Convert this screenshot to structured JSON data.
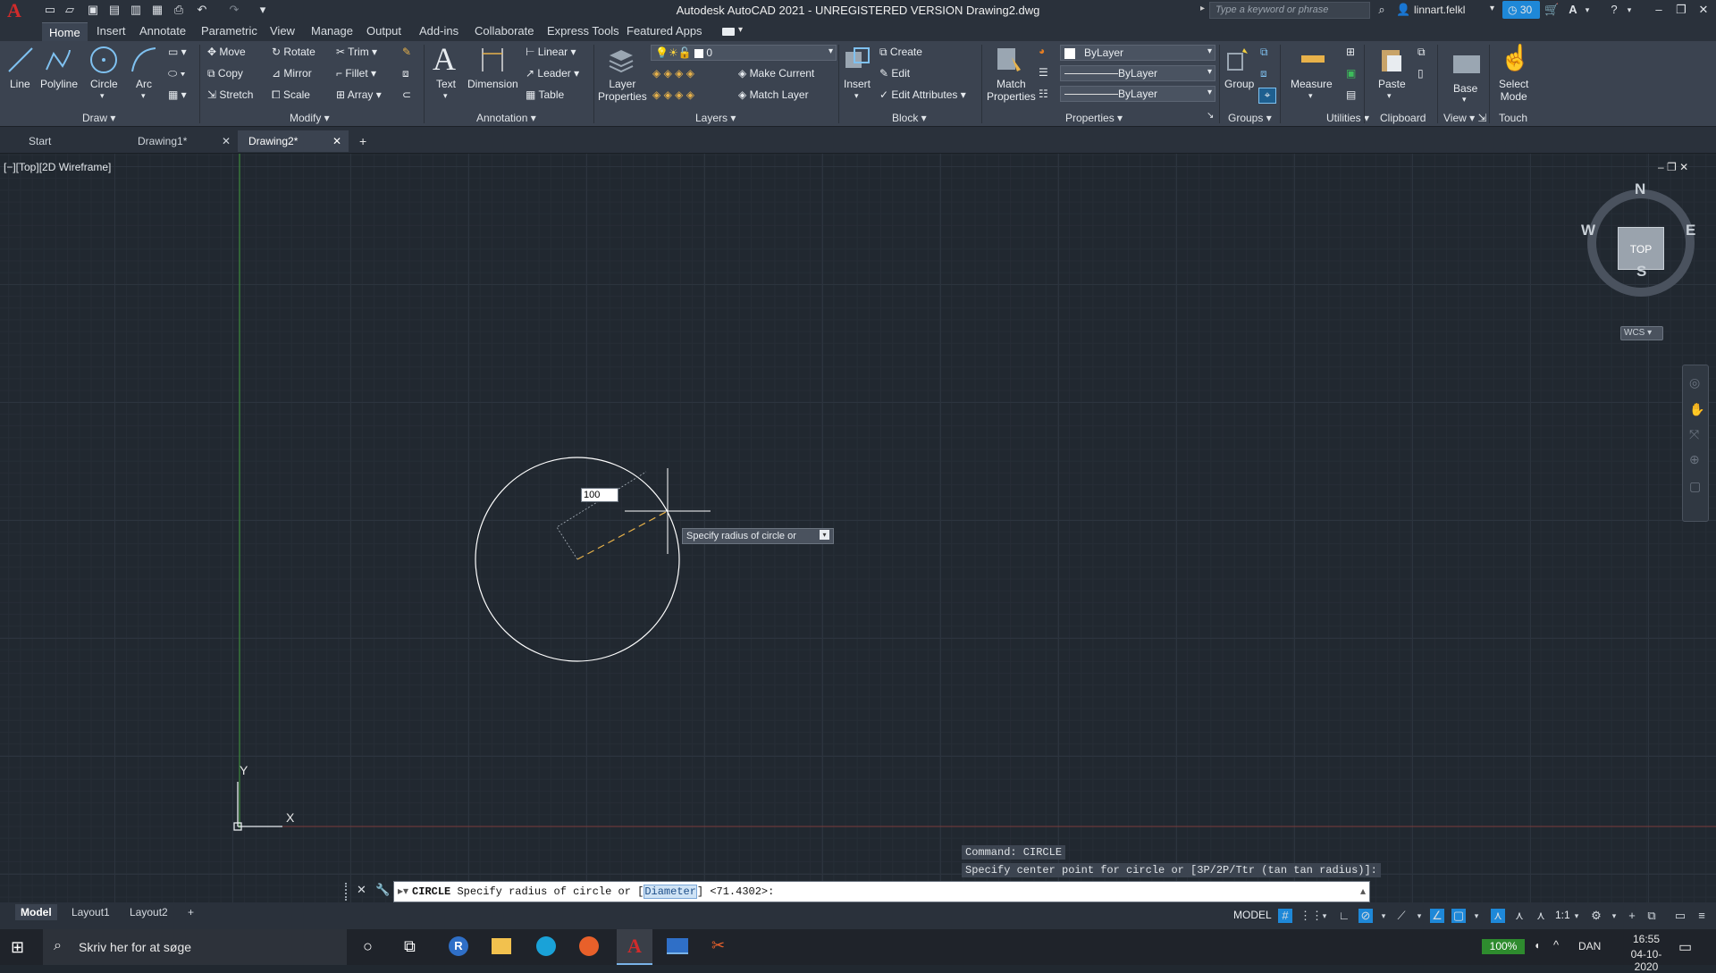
{
  "window": {
    "title": "Autodesk AutoCAD 2021 - UNREGISTERED VERSION    Drawing2.dwg",
    "search_placeholder": "Type a keyword or phrase",
    "user": "linnart.felkl",
    "trial_days": "30"
  },
  "menu_tabs": [
    "Home",
    "Insert",
    "Annotate",
    "Parametric",
    "View",
    "Manage",
    "Output",
    "Add-ins",
    "Collaborate",
    "Express Tools",
    "Featured Apps"
  ],
  "ribbon": {
    "draw": {
      "line": "Line",
      "polyline": "Polyline",
      "circle": "Circle",
      "arc": "Arc",
      "panel": "Draw"
    },
    "modify": {
      "move": "Move",
      "rotate": "Rotate",
      "trim": "Trim",
      "copy": "Copy",
      "mirror": "Mirror",
      "fillet": "Fillet",
      "stretch": "Stretch",
      "scale": "Scale",
      "array": "Array",
      "panel": "Modify"
    },
    "annotation": {
      "text": "Text",
      "dimension": "Dimension",
      "linear": "Linear",
      "leader": "Leader",
      "table": "Table",
      "panel": "Annotation"
    },
    "layers": {
      "layer_properties_1": "Layer",
      "layer_properties_2": "Properties",
      "layer_value": "0",
      "make_current": "Make Current",
      "match_layer": "Match Layer",
      "panel": "Layers"
    },
    "block": {
      "insert": "Insert",
      "create": "Create",
      "edit": "Edit",
      "edit_attributes": "Edit Attributes",
      "panel": "Block"
    },
    "properties": {
      "match_1": "Match",
      "match_2": "Properties",
      "color": "ByLayer",
      "linetype": "ByLayer",
      "lineweight": "ByLayer",
      "panel": "Properties"
    },
    "groups": {
      "group": "Group",
      "panel": "Groups"
    },
    "utilities": {
      "measure": "Measure",
      "panel": "Utilities"
    },
    "clipboard": {
      "paste": "Paste",
      "panel": "Clipboard"
    },
    "view": {
      "base": "Base",
      "panel": "View"
    },
    "touch": {
      "select_1": "Select",
      "select_2": "Mode",
      "panel": "Touch"
    }
  },
  "doc_tabs": [
    {
      "label": "Start"
    },
    {
      "label": "Drawing1*"
    },
    {
      "label": "Drawing2*"
    }
  ],
  "viewport": {
    "label": "[−][Top][2D Wireframe]",
    "radius_input": "100",
    "tooltip": "Specify radius of circle or",
    "ucs_y": "Y",
    "ucs_x": "X"
  },
  "viewcube": {
    "n": "N",
    "s": "S",
    "e": "E",
    "w": "W",
    "top": "TOP",
    "wcs": "WCS"
  },
  "command": {
    "history_1": "Command: CIRCLE",
    "history_2": "Specify center point for circle or [3P/2P/Ttr (tan tan radius)]:",
    "prompt_cmd": "CIRCLE",
    "prompt_text": "Specify radius of circle or [",
    "prompt_option": "Diameter",
    "prompt_tail": "] <71.4302>:"
  },
  "layout_tabs": [
    "Model",
    "Layout1",
    "Layout2"
  ],
  "status": {
    "model": "MODEL",
    "scale": "1:1"
  },
  "taskbar": {
    "search": "Skriv her for at søge",
    "battery": "100%",
    "lang": "DAN",
    "time": "16:55",
    "date": "04-10-2020"
  },
  "colors": {
    "accent": "#1e88d8",
    "ribbon": "#3b4350",
    "canvas": "#212830",
    "autocad_red": "#d12b2b"
  }
}
